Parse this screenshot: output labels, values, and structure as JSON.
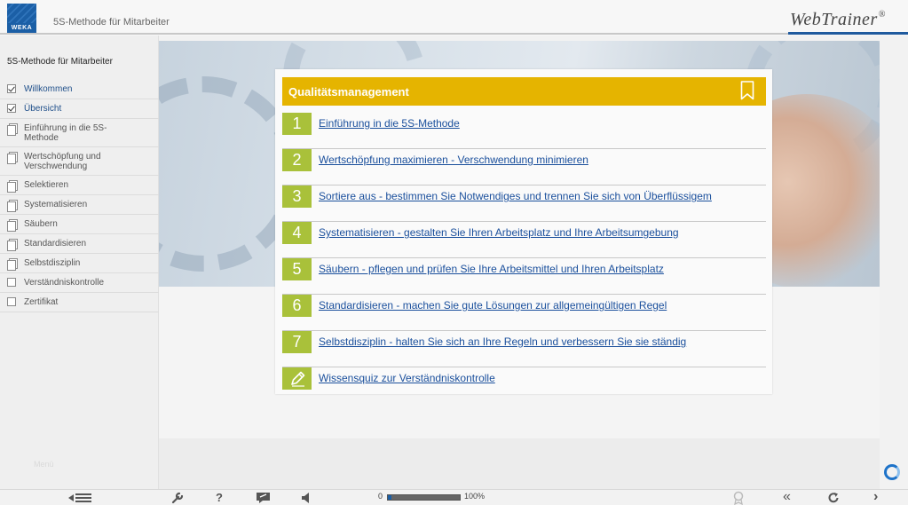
{
  "header": {
    "logo_text": "WEKA",
    "app_title": "5S-Methode für Mitarbeiter",
    "brand": "WebTrainer",
    "brand_mark": "®"
  },
  "sidebar": {
    "title": "5S-Methode für Mitarbeiter",
    "menu_label": "Menü",
    "items": [
      {
        "label": "Willkommen",
        "icon": "checkbox-checked"
      },
      {
        "label": "Übersicht",
        "icon": "checkbox-checked"
      },
      {
        "label": "Einführung in die 5S-Methode",
        "icon": "page-icon"
      },
      {
        "label": "Wertschöpfung und Verschwendung",
        "icon": "page-icon"
      },
      {
        "label": "Selektieren",
        "icon": "page-icon"
      },
      {
        "label": "Systematisieren",
        "icon": "page-icon"
      },
      {
        "label": "Säubern",
        "icon": "page-icon"
      },
      {
        "label": "Standardisieren",
        "icon": "page-icon"
      },
      {
        "label": "Selbstdisziplin",
        "icon": "page-icon"
      },
      {
        "label": "Verständniskontrolle",
        "icon": "checkbox-empty"
      },
      {
        "label": "Zertifikat",
        "icon": "checkbox-empty"
      }
    ]
  },
  "card": {
    "title": "Qualitätsmanagement",
    "icon": "bookmark-icon",
    "accent": "#e5b400",
    "number_color": "#a9c13a",
    "rows": [
      {
        "num": "1",
        "text": "Einführung in die 5S-Methode"
      },
      {
        "num": "2",
        "text": "Wertschöpfung maximieren - Verschwendung minimieren"
      },
      {
        "num": "3",
        "text": "Sortiere aus - bestimmen Sie Notwendiges und trennen Sie sich von Überflüssigem"
      },
      {
        "num": "4",
        "text": "Systematisieren - gestalten Sie Ihren Arbeitsplatz und Ihre Arbeitsumgebung"
      },
      {
        "num": "5",
        "text": "Säubern - pflegen und prüfen Sie Ihre Arbeitsmittel und Ihren Arbeitsplatz"
      },
      {
        "num": "6",
        "text": "Standardisieren - machen Sie gute Lösungen zur allgemeingültigen Regel"
      },
      {
        "num": "7",
        "text": "Selbstdisziplin - halten Sie sich an Ihre Regeln und verbessern Sie sie ständig"
      }
    ],
    "quiz": {
      "icon": "pencil-icon",
      "text": "Wissensquiz zur Verständniskontrolle"
    }
  },
  "footer": {
    "progress_start": "0",
    "progress_end": "100%",
    "progress_value": 0.05,
    "icons": [
      "collapse-menu-icon",
      "wrench-icon",
      "help-icon",
      "notes-icon",
      "speaker-icon",
      "certificate-icon",
      "back-icon",
      "reload-icon",
      "next-icon"
    ]
  }
}
